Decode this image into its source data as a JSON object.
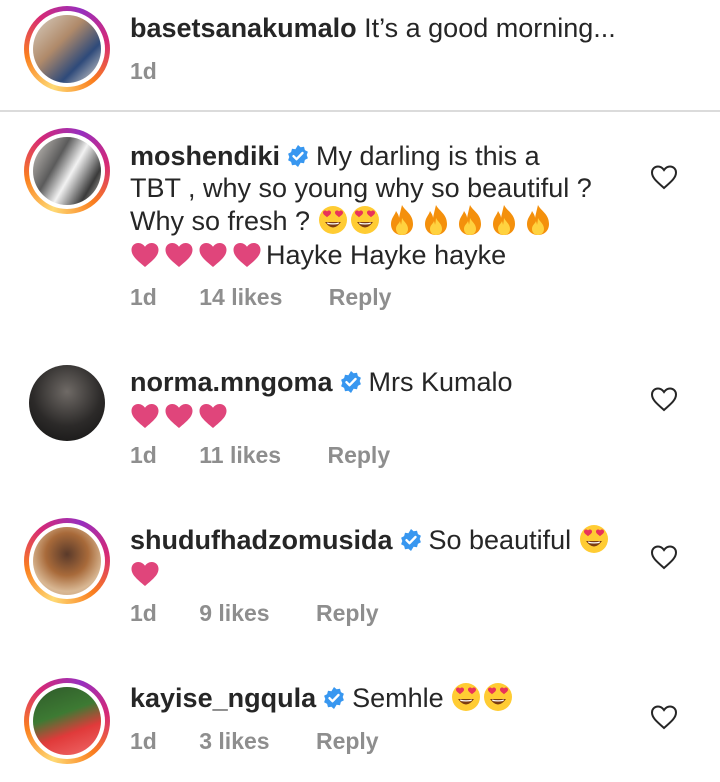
{
  "caption": {
    "username": "basetsanakumalo",
    "text": "It’s a good morning...",
    "time": "1d"
  },
  "comments": [
    {
      "username": "moshendiki",
      "verified": true,
      "text_line1": "My darling is this a",
      "text_line2": "TBT , why so young why so beautiful ?",
      "text_line3": "Why so fresh ?",
      "text_line4": "Hayke Hayke hayke",
      "time": "1d",
      "likes": "14 likes",
      "reply": "Reply"
    },
    {
      "username": "norma.mngoma",
      "verified": true,
      "text": "Mrs Kumalo",
      "time": "1d",
      "likes": "11 likes",
      "reply": "Reply"
    },
    {
      "username": "shudufhadzomusida",
      "verified": true,
      "text": "So beautiful",
      "time": "1d",
      "likes": "9 likes",
      "reply": "Reply"
    },
    {
      "username": "kayise_ngqula",
      "verified": true,
      "text": "Semhle",
      "time": "1d",
      "likes": "3 likes",
      "reply": "Reply"
    }
  ],
  "icons": {
    "verified": "verified-badge-icon",
    "like": "heart-outline-icon",
    "heart_eyes": "heart-eyes-emoji",
    "fire": "fire-emoji",
    "heart": "red-heart-emoji"
  },
  "colors": {
    "verified_blue": "#3897f0",
    "meta_gray": "#8e8e8e",
    "heart_pink": "#e0457b",
    "fire_orange": "#f4900c"
  }
}
